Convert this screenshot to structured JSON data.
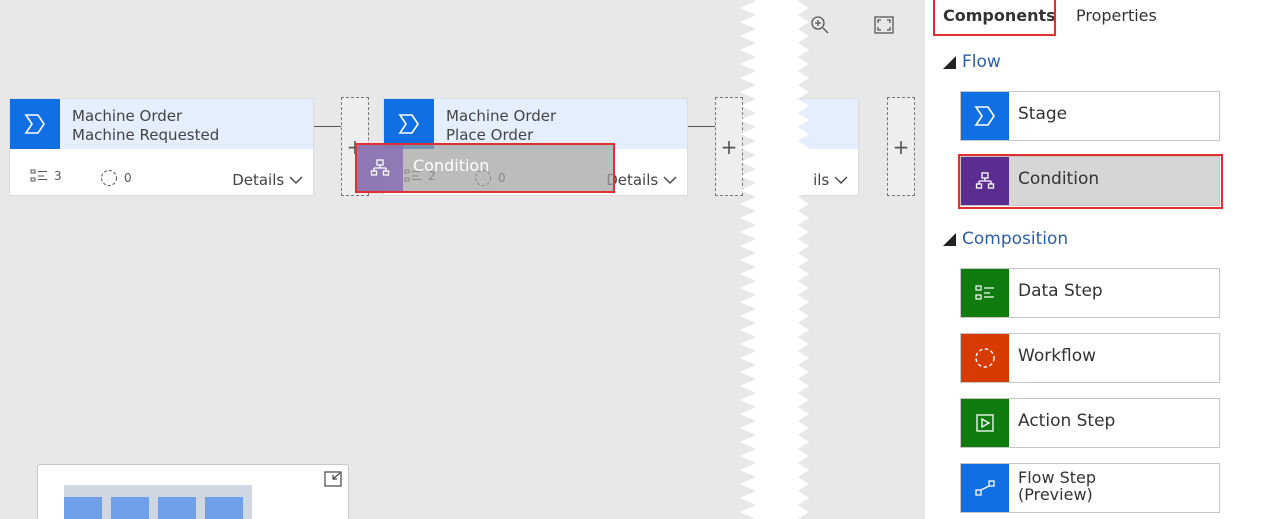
{
  "canvas": {
    "stages": [
      {
        "title_line1": "Machine Order",
        "title_line2": "Machine Requested",
        "steps_count": "3",
        "workflow_count": "0",
        "details_label": "Details"
      },
      {
        "title_line1": "Machine Order",
        "title_line2": "Place Order",
        "steps_count": "2",
        "workflow_count": "0",
        "details_label": "Details"
      }
    ],
    "partial_details_label": "ils",
    "plus_label": "+",
    "drag_ghost_label": "Condition",
    "toolbar": {
      "zoom_icon": "zoom-in-icon",
      "fit_icon": "fit-to-screen-icon"
    }
  },
  "panel": {
    "tabs": [
      {
        "label": "Components",
        "active": true
      },
      {
        "label": "Properties",
        "active": false
      }
    ],
    "sections": [
      {
        "title": "Flow",
        "items": [
          {
            "label": "Stage",
            "icon": "stage-icon",
            "color": "#0f6fe3"
          },
          {
            "label": "Condition",
            "icon": "condition-icon",
            "color": "#5c2d91"
          }
        ]
      },
      {
        "title": "Composition",
        "items": [
          {
            "label": "Data Step",
            "icon": "data-step-icon",
            "color": "#107c10"
          },
          {
            "label": "Workflow",
            "icon": "workflow-icon",
            "color": "#d83b01"
          },
          {
            "label": "Action Step",
            "icon": "action-step-icon",
            "color": "#107c10"
          },
          {
            "label_line1": "Flow Step",
            "label_line2": "(Preview)",
            "icon": "flow-step-icon",
            "color": "#0f6fe3"
          }
        ]
      }
    ]
  },
  "colors": {
    "accent_red": "#e03030",
    "section_blue": "#2c5fa5"
  }
}
